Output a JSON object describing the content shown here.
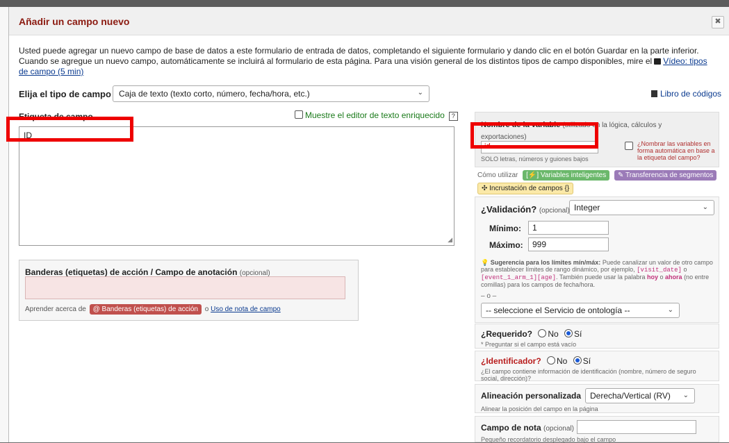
{
  "dialog": {
    "title": "Añadir un campo nuevo",
    "close_glyph": "✖"
  },
  "intro": {
    "text": "Usted puede agregar un nuevo campo de base de datos a este formulario de entrada de datos, completando el siguiente formulario y dando clic en el botón Guardar en la parte inferior. Cuando se agregue un nuevo campo, automáticamente se incluirá al formulario de esta página. Para una visión general de los distintos tipos de campo disponibles, mire el",
    "video_link": "Vídeo: tipos de campo (5 min)"
  },
  "field_type": {
    "label": "Elija el tipo de campo",
    "value": "Caja de texto (texto corto, número, fecha/hora, etc.)"
  },
  "codebook_link": "Libro de códigos",
  "field_label": {
    "title": "Etiqueta de campo",
    "rich_text_toggle": "Muestre el editor de texto enriquecido",
    "help": "?",
    "value": "ID"
  },
  "annotation": {
    "title": "Banderas (etiquetas) de acción / Campo de anotación",
    "optional": "(opcional)",
    "learn_prefix": "Aprender acerca de",
    "action_tags_button": "@ Banderas (etiquetas) de acción",
    "or": "o",
    "field_note_link": "Uso de nota de campo"
  },
  "variable": {
    "label": "Nombre de la variable",
    "label_note": "(utilizado en la lógica, cálculos y exportaciones)",
    "value": "id",
    "hint": "SOLO letras, números y guiones bajos",
    "auto_name": "¿Nombrar las variables en forma automática en base a la etiqueta del campo?"
  },
  "howto": {
    "label": "Cómo utilizar",
    "smart_variables": "[⚡] Variables inteligentes",
    "piping": "✎ Transferencia de segmentos",
    "field_embedding": "✣ Incrustación de campos {}"
  },
  "validation": {
    "label": "¿Validación?",
    "optional": "(opcional)",
    "value": "Integer",
    "min_label": "Mínimo:",
    "min_value": "1",
    "max_label": "Máximo:",
    "max_value": "999",
    "tip_title": "Sugerencia para los límites mín/máx:",
    "tip_part1": "Puede canalizar un valor de otro campo para establecer límites de rango dinámico, por ejemplo,",
    "tip_code1": "[visit_date]",
    "tip_or": "o",
    "tip_code2": "[event_1_arm_1][age]",
    "tip_part2": ". También puede usar la palabra",
    "tip_today": "hoy",
    "tip_o2": "o",
    "tip_now": "ahora",
    "tip_part3": "(no entre comillas) para los campos de fecha/hora.",
    "or_sep": "– o –",
    "ontology": "-- seleccione el Servicio de ontología --"
  },
  "required": {
    "label": "¿Requerido?",
    "no": "No",
    "yes": "Sí",
    "selected": "yes",
    "hint": "* Preguntar si el campo está vacío"
  },
  "identifier": {
    "label": "¿Identificador?",
    "no": "No",
    "yes": "Sí",
    "selected": "yes",
    "hint": "¿El campo contiene información de identificación (nombre, número de seguro social, dirección)?"
  },
  "alignment": {
    "label": "Alineación personalizada",
    "value": "Derecha/Vertical (RV)",
    "hint": "Alinear la posición del campo en la página"
  },
  "field_note": {
    "label": "Campo de nota",
    "optional": "(opcional)",
    "hint": "Pequeño recordatorio desplegado bajo el campo"
  },
  "colors": {
    "title": "#8b1a10",
    "highlight_box": "#ee0000",
    "link": "#0a3a8f"
  }
}
